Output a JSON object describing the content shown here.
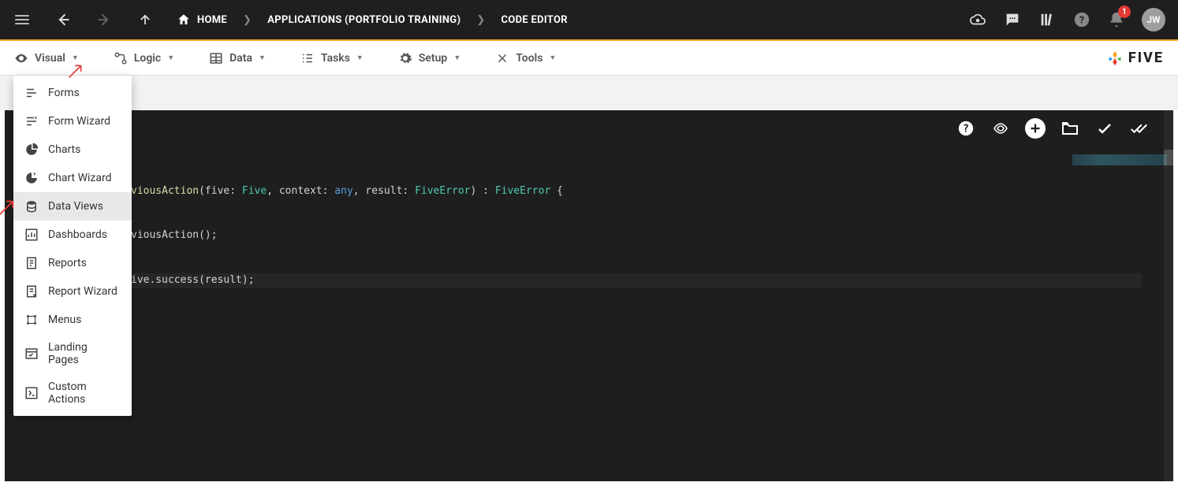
{
  "topbar": {
    "breadcrumbs": [
      {
        "label": "HOME"
      },
      {
        "label": "APPLICATIONS (PORTFOLIO TRAINING)"
      },
      {
        "label": "CODE EDITOR"
      }
    ],
    "notification_count": "1",
    "avatar_initials": "JW"
  },
  "menubar": {
    "items": [
      {
        "label": "Visual"
      },
      {
        "label": "Logic"
      },
      {
        "label": "Data"
      },
      {
        "label": "Tasks"
      },
      {
        "label": "Setup"
      },
      {
        "label": "Tools"
      }
    ],
    "brand": "FIVE"
  },
  "dropdown": {
    "items": [
      {
        "label": "Forms"
      },
      {
        "label": "Form Wizard"
      },
      {
        "label": "Charts"
      },
      {
        "label": "Chart Wizard"
      },
      {
        "label": "Data Views",
        "active": true
      },
      {
        "label": "Dashboards"
      },
      {
        "label": "Reports"
      },
      {
        "label": "Report Wizard"
      },
      {
        "label": "Menus"
      },
      {
        "label": "Landing Pages"
      },
      {
        "label": "Custom Actions"
      }
    ]
  },
  "editor": {
    "code_lines": [
      {
        "pre": "viousAction(five: ",
        "t1": "Five",
        "mid1": ", context: ",
        "t2": "any",
        "mid2": ", result: ",
        "t3": "FiveError",
        "mid3": ") : ",
        "t4": "FiveError",
        "post": " {"
      },
      {
        "plain": "viousAction();"
      },
      {
        "plain": "ive.success(result);"
      }
    ]
  }
}
